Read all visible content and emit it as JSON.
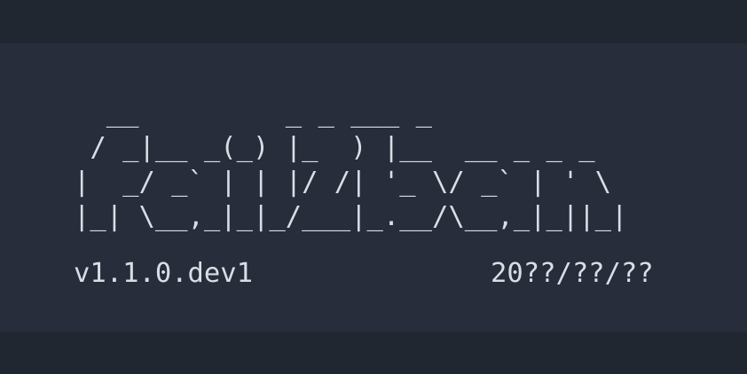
{
  "banner": {
    "ascii_art": "  __         _ _ ___ _\n / _|__ _(_) |_  ) |__  __ _ _ _\n|  _/ _` | | |/ /| '_ \\/ _` | ' \\\n|_| \\__,_|_|_/___|_.__/\\__,_|_||_|",
    "version": "v1.1.0.dev1",
    "date": "20??/??/??"
  },
  "colors": {
    "background": "#212730",
    "panel": "#272d3a",
    "text": "#d9dde5"
  }
}
